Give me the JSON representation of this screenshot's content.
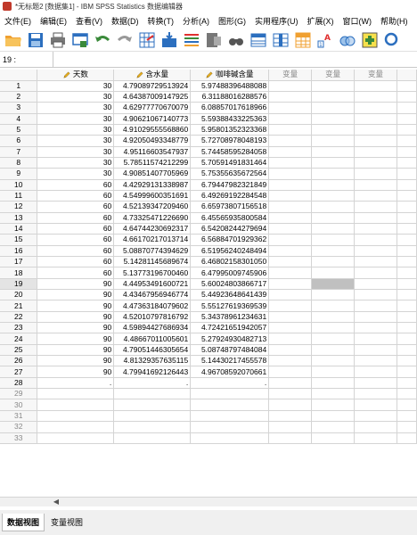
{
  "window": {
    "title": "*无标题2 [数据集1] - IBM SPSS Statistics 数据编辑器"
  },
  "menu": [
    "文件(E)",
    "编辑(E)",
    "查看(V)",
    "数据(D)",
    "转换(T)",
    "分析(A)",
    "图形(G)",
    "实用程序(U)",
    "扩展(X)",
    "窗口(W)",
    "帮助(H)"
  ],
  "cellbar": {
    "ref": "19 :",
    "value": ""
  },
  "columns": [
    "天数",
    "含水量",
    "咖啡碱含量",
    "变量",
    "变量",
    "变量"
  ],
  "rows": [
    [
      "1",
      "30",
      "4.79089729513924",
      "5.97488396488088"
    ],
    [
      "2",
      "30",
      "4.64387009147925",
      "6.31188016288576"
    ],
    [
      "3",
      "30",
      "4.62977770670079",
      "6.08857017618966"
    ],
    [
      "4",
      "30",
      "4.90621067140773",
      "5.59388433225363"
    ],
    [
      "5",
      "30",
      "4.91029555568860",
      "5.95801352323368"
    ],
    [
      "6",
      "30",
      "4.92050493348779",
      "5.72708978048193"
    ],
    [
      "7",
      "30",
      "4.95116603547937",
      "5.74458595284058"
    ],
    [
      "8",
      "30",
      "5.78511574212299",
      "5.70591491831464"
    ],
    [
      "9",
      "30",
      "4.90851407705969",
      "5.75355635672564"
    ],
    [
      "10",
      "60",
      "4.42929131338987",
      "6.79447982321849"
    ],
    [
      "11",
      "60",
      "4.54999600351691",
      "6.49269192284548"
    ],
    [
      "12",
      "60",
      "4.52139347209460",
      "6.65973807156518"
    ],
    [
      "13",
      "60",
      "4.73325471226690",
      "6.45565935800584"
    ],
    [
      "14",
      "60",
      "4.64744230692317",
      "6.54208244279694"
    ],
    [
      "15",
      "60",
      "4.66170217013714",
      "6.56884701929362"
    ],
    [
      "16",
      "60",
      "5.08870774394629",
      "6.51956240248494"
    ],
    [
      "17",
      "60",
      "5.14281145689674",
      "6.46802158301050"
    ],
    [
      "18",
      "60",
      "5.13773196700460",
      "6.47995009745906"
    ],
    [
      "19",
      "90",
      "4.44953491600721",
      "5.60024803866717"
    ],
    [
      "20",
      "90",
      "4.43467956946774",
      "5.44923648641439"
    ],
    [
      "21",
      "90",
      "4.47363184079602",
      "5.55127619369539"
    ],
    [
      "22",
      "90",
      "4.52010797816792",
      "5.34378961234631"
    ],
    [
      "23",
      "90",
      "4.59894427686934",
      "4.72421651942057"
    ],
    [
      "24",
      "90",
      "4.48667011005601",
      "5.27924930482713"
    ],
    [
      "25",
      "90",
      "4.79051446305654",
      "5.08748797484084"
    ],
    [
      "26",
      "90",
      "4.81329357635115",
      "5.14430217455578"
    ],
    [
      "27",
      "90",
      "4.79941692126443",
      "4.96708592070661"
    ],
    [
      "28",
      ".",
      ".",
      "."
    ],
    [
      "29",
      "",
      "",
      ""
    ],
    [
      "30",
      "",
      "",
      ""
    ],
    [
      "31",
      "",
      "",
      ""
    ],
    [
      "32",
      "",
      "",
      ""
    ],
    [
      "33",
      "",
      "",
      ""
    ]
  ],
  "selected_row": "19",
  "tabs": [
    "数据视图",
    "变量视图"
  ],
  "colors": {
    "selection": "#c0c0c0",
    "header_bg": "#f7f7f7",
    "gridline": "#d4d4d4"
  }
}
